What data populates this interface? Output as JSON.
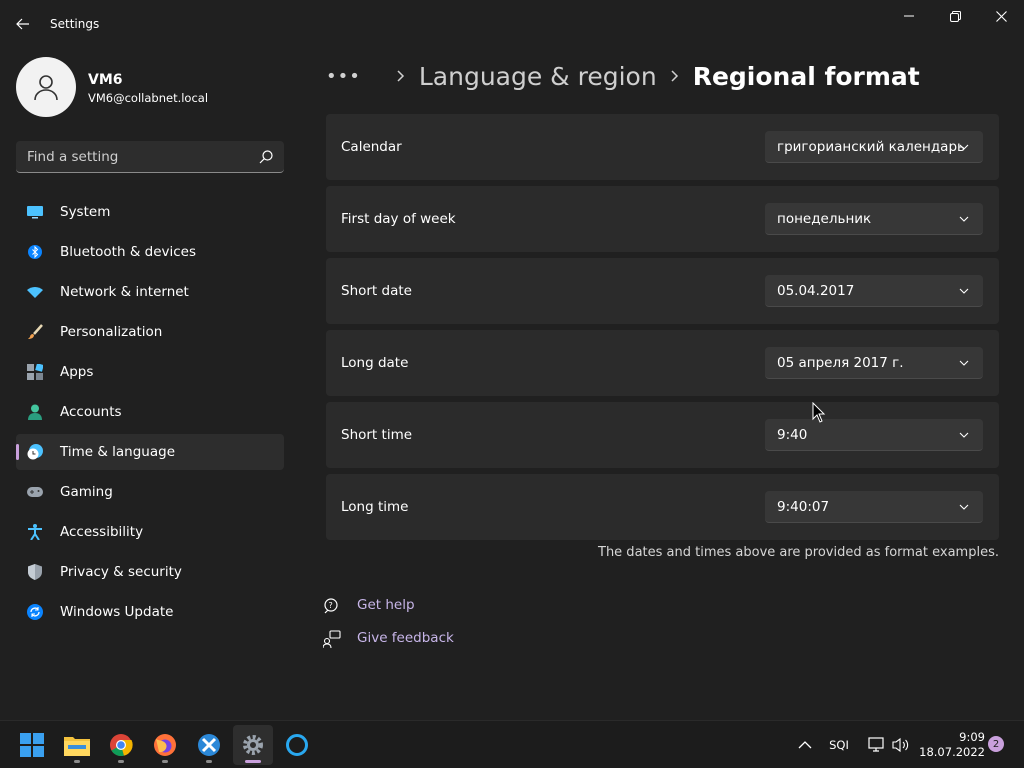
{
  "window": {
    "title": "Settings"
  },
  "profile": {
    "name": "VM6",
    "email": "VM6@collabnet.local"
  },
  "search": {
    "placeholder": "Find a setting"
  },
  "sidebar": {
    "items": [
      {
        "label": "System",
        "icon": "system-icon"
      },
      {
        "label": "Bluetooth & devices",
        "icon": "bluetooth-icon"
      },
      {
        "label": "Network & internet",
        "icon": "network-icon"
      },
      {
        "label": "Personalization",
        "icon": "brush-icon"
      },
      {
        "label": "Apps",
        "icon": "apps-icon"
      },
      {
        "label": "Accounts",
        "icon": "accounts-icon"
      },
      {
        "label": "Time & language",
        "icon": "time-language-icon",
        "active": true
      },
      {
        "label": "Gaming",
        "icon": "gamepad-icon"
      },
      {
        "label": "Accessibility",
        "icon": "accessibility-icon"
      },
      {
        "label": "Privacy & security",
        "icon": "shield-icon"
      },
      {
        "label": "Windows Update",
        "icon": "update-icon"
      }
    ]
  },
  "breadcrumb": {
    "overflow": "•••",
    "parent": "Language & region",
    "current": "Regional format"
  },
  "settings": [
    {
      "label": "Calendar",
      "value": "григорианский календарь"
    },
    {
      "label": "First day of week",
      "value": "понедельник"
    },
    {
      "label": "Short date",
      "value": "05.04.2017"
    },
    {
      "label": "Long date",
      "value": "05 апреля 2017 г."
    },
    {
      "label": "Short time",
      "value": "9:40"
    },
    {
      "label": "Long time",
      "value": "9:40:07"
    }
  ],
  "footnote": "The dates and times above are provided as format examples.",
  "links": {
    "help": "Get help",
    "feedback": "Give feedback"
  },
  "taskbar": {
    "apps": [
      "windows-start-icon",
      "file-explorer-icon",
      "chrome-icon",
      "firefox-icon",
      "app-icon",
      "settings-gear-icon",
      "cortana-icon"
    ],
    "language": "SQI",
    "time": "9:09",
    "date": "18.07.2022",
    "notifications": "2"
  },
  "colors": {
    "background": "#202020",
    "card": "#2b2b2b",
    "accent": "#c9a0dc",
    "link": "#c7b5e8"
  }
}
